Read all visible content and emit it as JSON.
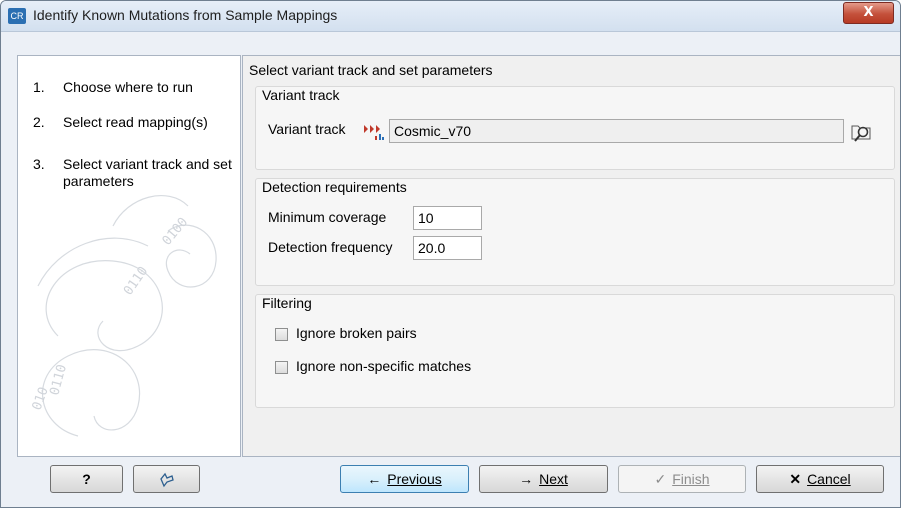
{
  "window": {
    "title": "Identify Known Mutations from Sample Mappings",
    "app_icon_text": "CR",
    "close_label": "X"
  },
  "steps": [
    {
      "num": "1.",
      "label": "Choose where to run"
    },
    {
      "num": "2.",
      "label": "Select read mapping(s)"
    },
    {
      "num": "3.",
      "label": "Select variant track and set parameters"
    }
  ],
  "main": {
    "heading": "Select variant track and set parameters",
    "variant_group": {
      "title": "Variant track",
      "field_label": "Variant track",
      "value": "Cosmic_v70",
      "track_icon": "variant-track-icon",
      "browse_icon": "browse-folder-icon"
    },
    "detection_group": {
      "title": "Detection requirements",
      "min_coverage_label": "Minimum coverage",
      "min_coverage_value": "10",
      "detection_freq_label": "Detection frequency",
      "detection_freq_value": "20.0"
    },
    "filtering_group": {
      "title": "Filtering",
      "ignore_broken_pairs": "Ignore broken pairs",
      "ignore_nonspecific": "Ignore non-specific matches",
      "ignore_broken_pairs_checked": false,
      "ignore_nonspecific_checked": false
    }
  },
  "footer": {
    "help_label": "?",
    "previous_label": "Previous",
    "next_label": "Next",
    "finish_label": "Finish",
    "cancel_label": "Cancel"
  },
  "colors": {
    "accent": "#3c7fb1",
    "close_red": "#c4513b",
    "track_icon": "#c0392b"
  }
}
